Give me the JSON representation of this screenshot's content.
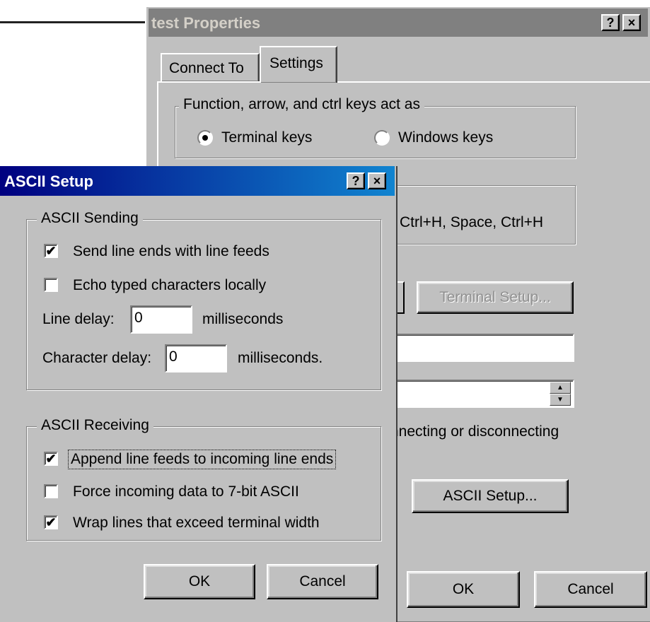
{
  "background_window": {
    "title": "test Properties",
    "help_button": "?",
    "close_button": "×",
    "tabs": [
      "Connect To",
      "Settings"
    ],
    "group_function_keys": {
      "legend": "Function, arrow, and ctrl keys act as",
      "terminal_keys": "Terminal keys",
      "windows_keys": "Windows keys",
      "selected": "terminal_keys"
    },
    "backspace_text": "Ctrl+H, Space, Ctrl+H",
    "terminal_setup_button": "Terminal Setup...",
    "connecting_text": "nnecting or disconnecting",
    "ascii_setup_button": "ASCII Setup...",
    "ok_button": "OK",
    "cancel_button": "Cancel"
  },
  "dialog": {
    "title": "ASCII Setup",
    "help_button": "?",
    "close_button": "×",
    "sending": {
      "legend": "ASCII Sending",
      "send_line_ends": {
        "label": "Send line ends with line feeds",
        "checked": true
      },
      "echo_typed": {
        "label": "Echo typed characters locally",
        "checked": false
      },
      "line_delay_label": "Line delay:",
      "line_delay_value": "0",
      "line_delay_unit": "milliseconds",
      "char_delay_label": "Character delay:",
      "char_delay_value": "0",
      "char_delay_unit": "milliseconds."
    },
    "receiving": {
      "legend": "ASCII Receiving",
      "append_line_feeds": {
        "label": "Append line feeds to incoming line ends",
        "checked": true
      },
      "force_7bit": {
        "label": "Force incoming data to 7-bit ASCII",
        "checked": false
      },
      "wrap_lines": {
        "label": "Wrap lines that exceed terminal width",
        "checked": true
      }
    },
    "ok_button": "OK",
    "cancel_button": "Cancel"
  },
  "check_glyph": "✔",
  "colors": {
    "title_active": "#000080",
    "title_inactive": "#808080",
    "face": "#c0c0c0"
  }
}
